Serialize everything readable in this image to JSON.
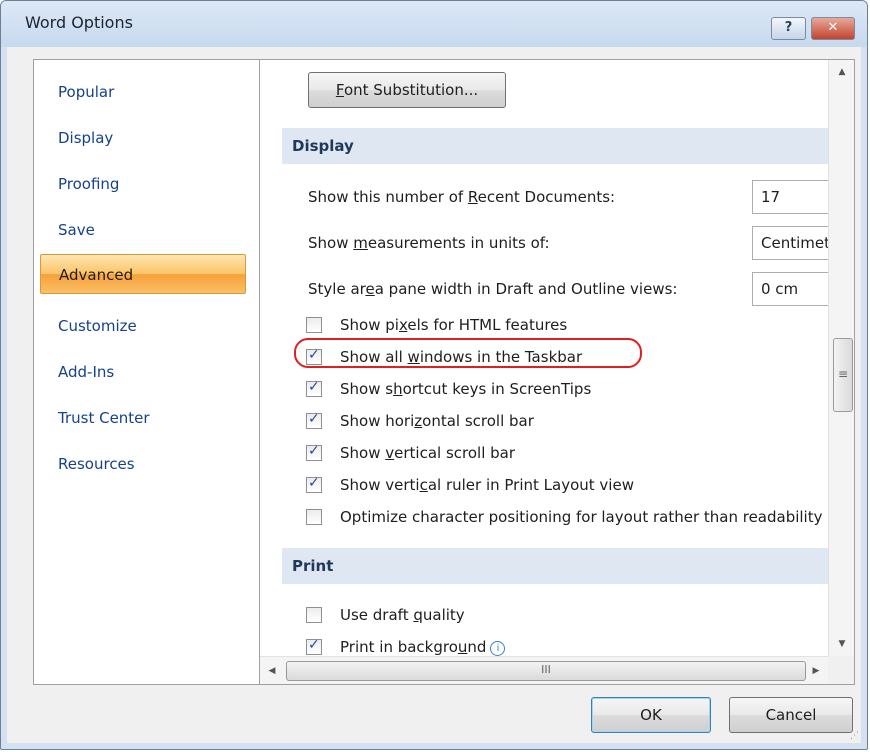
{
  "window": {
    "title": "Word Options",
    "help_glyph": "?",
    "close_glyph": "✕"
  },
  "nav": {
    "items": [
      {
        "label": "Popular"
      },
      {
        "label": "Display"
      },
      {
        "label": "Proofing"
      },
      {
        "label": "Save"
      },
      {
        "label": "Advanced"
      },
      {
        "label": "Customize"
      },
      {
        "label": "Add-Ins"
      },
      {
        "label": "Trust Center"
      },
      {
        "label": "Resources"
      }
    ],
    "selected": "Advanced"
  },
  "content": {
    "font_substitution_button": {
      "pre": "",
      "key": "F",
      "post": "ont Substitution..."
    },
    "display_section": {
      "header": "Display",
      "recent_docs": {
        "pre": "Show this number of ",
        "key": "R",
        "post": "ecent Documents:",
        "value": "17"
      },
      "units": {
        "pre": "Show ",
        "key": "m",
        "post": "easurements in units of:",
        "value": "Centimeters"
      },
      "style_area": {
        "pre": "Style ar",
        "key": "e",
        "post": "a pane width in Draft and Outline views:",
        "value": "0 cm"
      },
      "checkboxes": [
        {
          "pre": "Show pi",
          "key": "x",
          "post": "els for HTML features",
          "checked": false
        },
        {
          "pre": "Show all ",
          "key": "w",
          "post": "indows in the Taskbar",
          "checked": true,
          "highlighted": true
        },
        {
          "pre": "Show s",
          "key": "h",
          "post": "ortcut keys in ScreenTips",
          "checked": true
        },
        {
          "pre": "Show hori",
          "key": "z",
          "post": "ontal scroll bar",
          "checked": true
        },
        {
          "pre": "Show ",
          "key": "v",
          "post": "ertical scroll bar",
          "checked": true
        },
        {
          "pre": "Show verti",
          "key": "c",
          "post": "al ruler in Print Layout view",
          "checked": true
        },
        {
          "pre": "",
          "key": "",
          "post": "Optimize character positioning for layout rather than readability",
          "checked": false
        }
      ]
    },
    "print_section": {
      "header": "Print",
      "checkboxes": [
        {
          "pre": "Use draft ",
          "key": "q",
          "post": "uality",
          "checked": false
        },
        {
          "pre": "Print in backgro",
          "key": "u",
          "post": "nd",
          "checked": true,
          "info_icon": "i"
        }
      ]
    },
    "scrollbar_glyphs": {
      "up": "▲",
      "down": "▼",
      "left": "◀",
      "right": "▶",
      "v_grip": "≡",
      "h_grip": "III"
    }
  },
  "footer": {
    "ok_label": "OK",
    "cancel_label": "Cancel"
  },
  "colors": {
    "accent_selected": "#f7a13a",
    "section_header_bg": "#dfe7f2",
    "highlight_ring": "#e02020"
  }
}
